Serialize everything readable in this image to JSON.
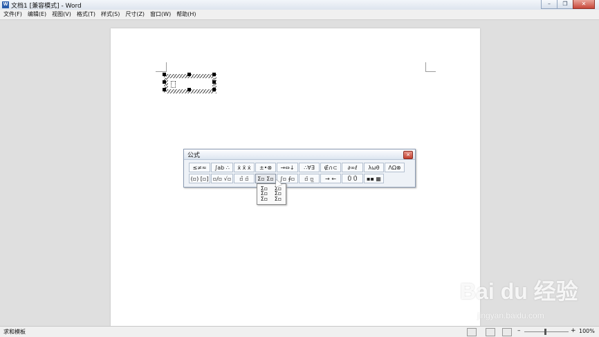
{
  "window": {
    "title": "文档1 [兼容模式] - Word",
    "app_icon": "W",
    "minimize": "–",
    "restore": "❐",
    "close": "✕"
  },
  "menu": [
    "文件(F)",
    "编辑(E)",
    "视图(V)",
    "格式(T)",
    "样式(S)",
    "尺寸(Z)",
    "窗口(W)",
    "帮助(H)"
  ],
  "formula_toolbar": {
    "title": "公式",
    "close": "✕",
    "row1": [
      "≤≠≈",
      "∫ab ∴",
      "ẋ ẍ ẋ",
      "±•⊗",
      "→⇔↓",
      "∴∀∃",
      "∉∩⊂",
      "∂∞ℓ",
      "λωθ",
      "ΛΩ⊗"
    ],
    "row2": [
      "(▫) [▫]",
      "▫/▫ √▫",
      "▫̂ ▫̄",
      "Σ▫ Σ▫",
      "∫▫ ∮▫",
      "▫̄ ▫̲",
      "→ ←",
      "Ů Ů",
      "▪▪ ▦"
    ]
  },
  "palette": {
    "items": [
      "Σ▫",
      "Σ▫",
      "Σ▫",
      "Σ▫",
      "Σ▫",
      "Σ▫"
    ]
  },
  "status": {
    "left_text": "求和模板",
    "zoom": "100%",
    "zoom_minus": "–",
    "zoom_plus": "+"
  },
  "watermark": {
    "brand": "Bai du 经验",
    "url": "jingyan.baidu.com"
  }
}
